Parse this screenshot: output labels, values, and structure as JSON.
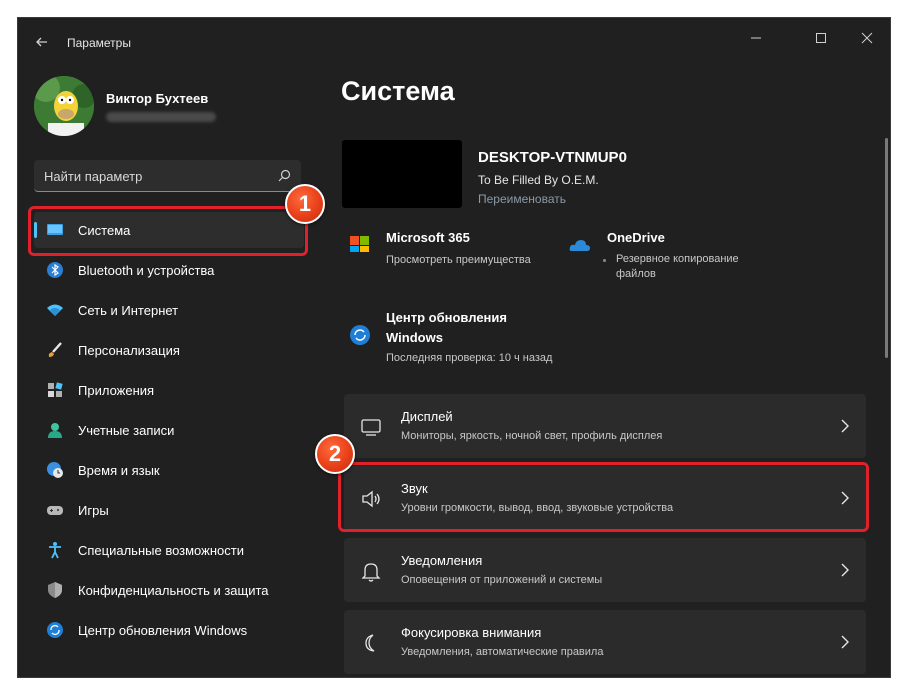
{
  "window": {
    "title": "Параметры"
  },
  "profile": {
    "name": "Виктор Бухтеев"
  },
  "search": {
    "placeholder": "Найти параметр"
  },
  "nav": {
    "items": [
      {
        "label": "Система",
        "icon": "monitor-icon"
      },
      {
        "label": "Bluetooth и устройства",
        "icon": "bluetooth-icon"
      },
      {
        "label": "Сеть и Интернет",
        "icon": "wifi-icon"
      },
      {
        "label": "Персонализация",
        "icon": "brush-icon"
      },
      {
        "label": "Приложения",
        "icon": "apps-icon"
      },
      {
        "label": "Учетные записи",
        "icon": "person-icon"
      },
      {
        "label": "Время и язык",
        "icon": "globe-clock-icon"
      },
      {
        "label": "Игры",
        "icon": "gamepad-icon"
      },
      {
        "label": "Специальные возможности",
        "icon": "accessibility-icon"
      },
      {
        "label": "Конфиденциальность и защита",
        "icon": "shield-icon"
      },
      {
        "label": "Центр обновления Windows",
        "icon": "update-icon"
      }
    ]
  },
  "annotations": {
    "badge1": "1",
    "badge2": "2"
  },
  "main": {
    "title": "Система",
    "device": {
      "name": "DESKTOP-VTNMUP0",
      "model": "To Be Filled By O.E.M.",
      "rename": "Переименовать"
    },
    "tiles": {
      "m365": {
        "title": "Microsoft 365",
        "sub": "Просмотреть преимущества"
      },
      "onedrive": {
        "title": "OneDrive",
        "sub1": "Резервное копирование",
        "sub2": "файлов"
      },
      "update": {
        "title1": "Центр обновления",
        "title2": "Windows",
        "sub": "Последняя проверка: 10 ч назад"
      }
    },
    "cards": [
      {
        "title": "Дисплей",
        "sub": "Мониторы, яркость, ночной свет, профиль дисплея",
        "icon": "display-icon"
      },
      {
        "title": "Звук",
        "sub": "Уровни громкости, вывод, ввод, звуковые устройства",
        "icon": "speaker-icon"
      },
      {
        "title": "Уведомления",
        "sub": "Оповещения от приложений и системы",
        "icon": "bell-icon"
      },
      {
        "title": "Фокусировка внимания",
        "sub": "Уведомления, автоматические правила",
        "icon": "moon-icon"
      }
    ]
  },
  "colors": {
    "accent": "#4cc2ff",
    "annotation": "#e0202a",
    "background": "#202020",
    "card": "#2b2b2b"
  }
}
